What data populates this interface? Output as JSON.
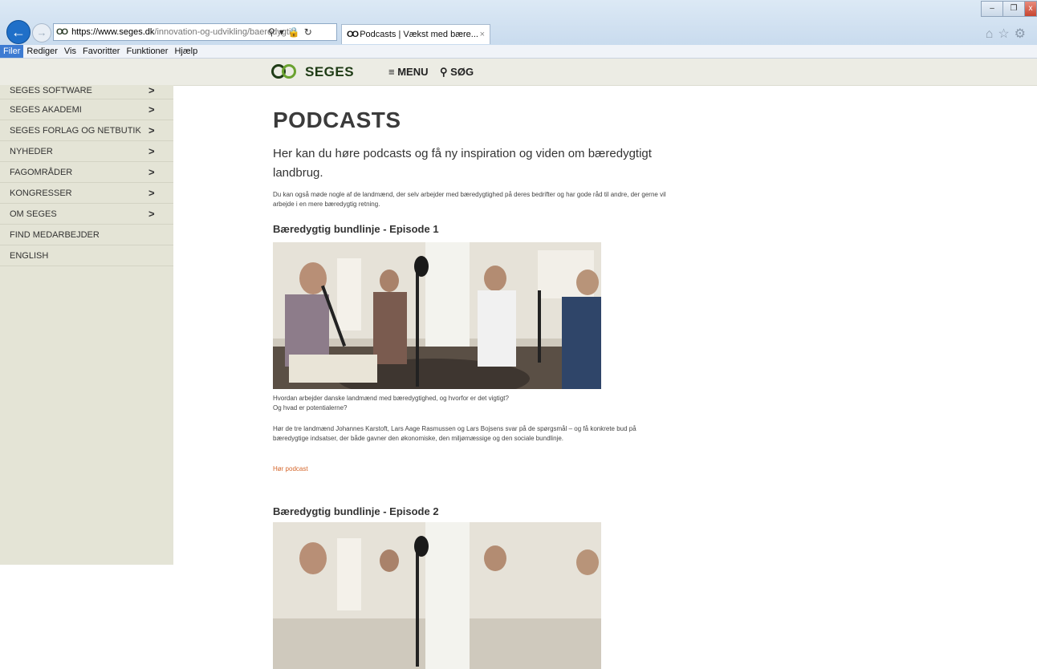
{
  "browser": {
    "url_host": "https://www.seges.dk",
    "url_rest": "/innovation-og-udvikling/baeredygtig",
    "tab_title": "Podcasts | Vækst med bære...",
    "tab_close": "×",
    "menus": [
      "Filer",
      "Rediger",
      "Vis",
      "Favoritter",
      "Funktioner",
      "Hjælp"
    ]
  },
  "header": {
    "brand": "SEGES",
    "menu_label": "≡ MENU",
    "search_label": "SØG"
  },
  "sidebar": {
    "items": [
      {
        "label": "SEGES SOFTWARE",
        "chevron": ">"
      },
      {
        "label": "SEGES AKADEMI",
        "chevron": ">"
      },
      {
        "label": "SEGES FORLAG OG NETBUTIK",
        "chevron": ">"
      },
      {
        "label": "NYHEDER",
        "chevron": ">"
      },
      {
        "label": "FAGOMRÅDER",
        "chevron": ">"
      },
      {
        "label": "KONGRESSER",
        "chevron": ">"
      },
      {
        "label": "OM SEGES",
        "chevron": ">"
      },
      {
        "label": "FIND MEDARBEJDER",
        "chevron": ""
      },
      {
        "label": "ENGLISH",
        "chevron": ""
      }
    ]
  },
  "main": {
    "title": "PODCASTS",
    "lead": "Her kan du høre podcasts og få ny inspiration og viden om bæredygtigt landbrug.",
    "intro": "Du kan også møde nogle af de landmænd, der selv arbejder med bæredygtighed på deres bedrifter og har gode råd til andre, der gerne vil arbejde i en mere bæredygtig retning.",
    "episodes": [
      {
        "title": "Bæredygtig bundlinje - Episode 1",
        "question": "Hvordan arbejder danske landmænd med bæredygtighed, og hvorfor er det vigtigt?",
        "question2": "Og hvad er potentialerne?",
        "description": "Hør de tre landmænd Johannes Karstoft, Lars Aage Rasmussen og Lars Bojsens svar på de spørgsmål – og få konkrete bud på bæredygtige indsatser, der både gavner den økonomiske, den miljømæssige og den sociale bundlinje.",
        "link": "Hør podcast"
      },
      {
        "title": "Bæredygtig bundlinje - Episode 2"
      }
    ]
  }
}
